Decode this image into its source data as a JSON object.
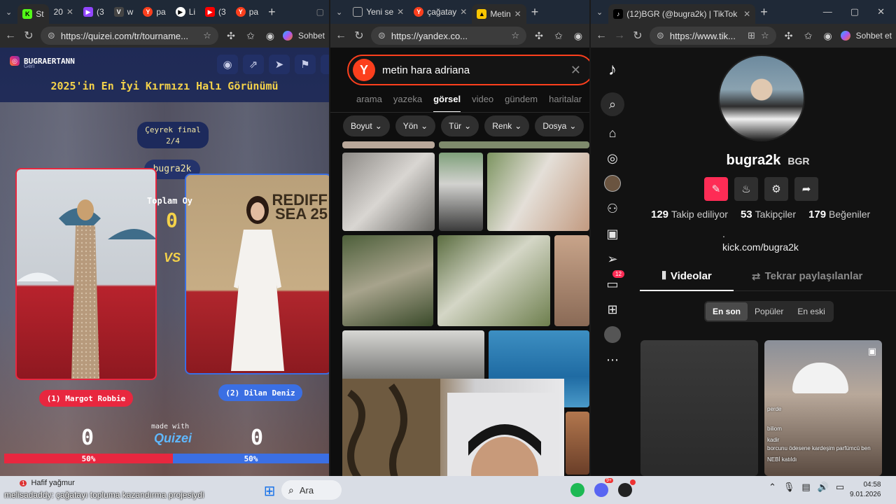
{
  "window1": {
    "tabs": [
      {
        "label": "St",
        "icon": "kick-icon"
      },
      {
        "label": "20",
        "icon": "doc-icon"
      },
      {
        "label": "(3",
        "icon": "twitch-icon"
      },
      {
        "label": "w",
        "icon": "v-icon"
      },
      {
        "label": "pa",
        "icon": "yandex-icon"
      },
      {
        "label": "Li",
        "icon": "play-icon"
      },
      {
        "label": "(3",
        "icon": "youtube-icon"
      },
      {
        "label": "pa",
        "icon": "yandex-icon"
      }
    ],
    "url": "https://quizei.com/tr/tourname...",
    "chat_label": "Sohbet",
    "instagram_handle": "BUGRAERTANN",
    "subtitle_small": "Geri",
    "title": "2025'in En İyi Kırmızı Halı Görünümü",
    "round_label": "Çeyrek final",
    "round_progress": "2/4",
    "streamer_tag": "bugra2k",
    "total_votes_label": "Toplam Oy",
    "total_votes_value": "0",
    "vs_label": "VS",
    "left_name": "(1) Margot Robbie",
    "right_name": "(2) Dilan Deniz",
    "left_votes": "0",
    "right_votes": "0",
    "left_percent": "50%",
    "right_percent": "50%",
    "made_with": "made with",
    "brand": "Quizei",
    "backdrop_text": "REDIFF\nSEA 25",
    "left_color": "#e8273f",
    "right_color": "#3b6fe3"
  },
  "window2": {
    "tabs": [
      {
        "label": "Yeni se",
        "icon": "page-icon"
      },
      {
        "label": "çağatay",
        "icon": "yandex-icon"
      },
      {
        "label": "Metin",
        "icon": "image-icon"
      }
    ],
    "url": "https://yandex.co...",
    "search_query": "metin hara adriana",
    "nav_tabs": [
      "arama",
      "yazeka",
      "görsel",
      "video",
      "gündem",
      "haritalar"
    ],
    "active_nav": "görsel",
    "filters": [
      "Boyut",
      "Yön",
      "Tür",
      "Renk",
      "Dosya"
    ]
  },
  "window3": {
    "tab_title": "(12)BGR (@bugra2k) | TikTok",
    "url": "https://www.tik...",
    "chat_label": "Sohbet et",
    "username": "bugra2k",
    "nickname": "BGR",
    "following_count": "129",
    "following_label": "Takip ediliyor",
    "followers_count": "53",
    "followers_label": "Takipçiler",
    "likes_count": "179",
    "likes_label": "Beğeniler",
    "bio_dot": ".",
    "bio_link": "kick.com/bugra2k",
    "tab_videos": "Videolar",
    "tab_reposts": "Tekrar paylaşılanlar",
    "sort": [
      "En son",
      "Popüler",
      "En eski"
    ],
    "inbox_badge": "12",
    "video_overlay": [
      "perde",
      "biliom",
      "kadir",
      "borcunu ödesene kardeşim parfümcü ben",
      "NEBİ katıldı"
    ]
  },
  "taskbar": {
    "weather": "Hafif yağmur",
    "weather_badge": "1",
    "search_label": "Ara",
    "time": "04:58",
    "date": "9.01.2026",
    "tray_badge": "9+"
  },
  "stream_overlay": {
    "chat_user": "melisadaddy",
    "chat_message": ": çağatayı topluma kazandırma projesiydi"
  }
}
